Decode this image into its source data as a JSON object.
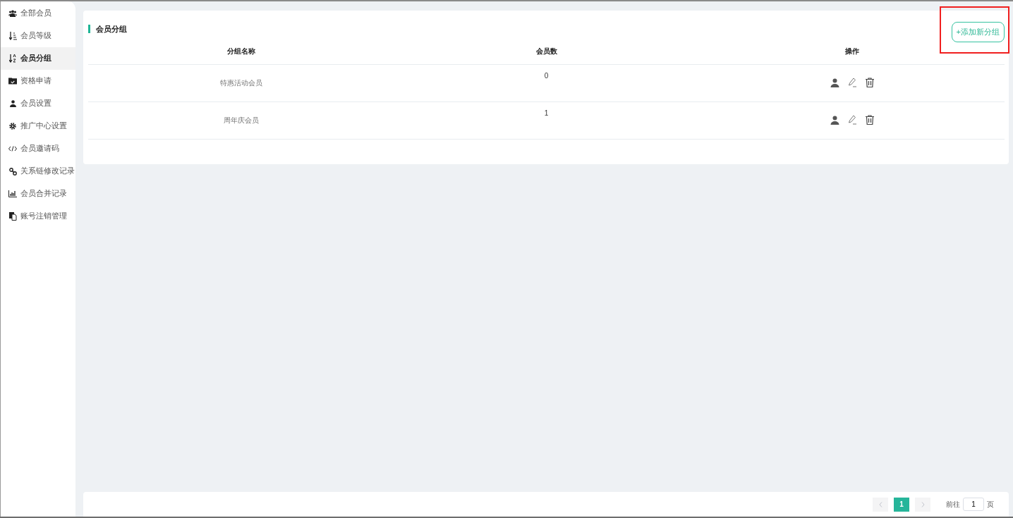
{
  "sidebar": {
    "items": [
      {
        "label": "全部会员",
        "selected": false
      },
      {
        "label": "会员等级",
        "selected": false
      },
      {
        "label": "会员分组",
        "selected": true
      },
      {
        "label": "资格申请",
        "selected": false
      },
      {
        "label": "会员设置",
        "selected": false
      },
      {
        "label": "推广中心设置",
        "selected": false
      },
      {
        "label": "会员邀请码",
        "selected": false
      },
      {
        "label": "关系链修改记录",
        "selected": false
      },
      {
        "label": "会员合并记录",
        "selected": false
      },
      {
        "label": "账号注销管理",
        "selected": false
      }
    ]
  },
  "panel": {
    "title": "会员分组",
    "add_button": {
      "label": "+添加新分组",
      "highlighted": true
    }
  },
  "table": {
    "columns": [
      "分组名称",
      "会员数",
      "操作"
    ],
    "rows": [
      {
        "name": "特惠活动会员",
        "count": "0"
      },
      {
        "name": "周年庆会员",
        "count": "1"
      }
    ]
  },
  "pagination": {
    "pages": [
      {
        "label": "1",
        "selected": true
      }
    ],
    "goto_label": "前往",
    "goto_value": "1",
    "page_unit": "页"
  }
}
